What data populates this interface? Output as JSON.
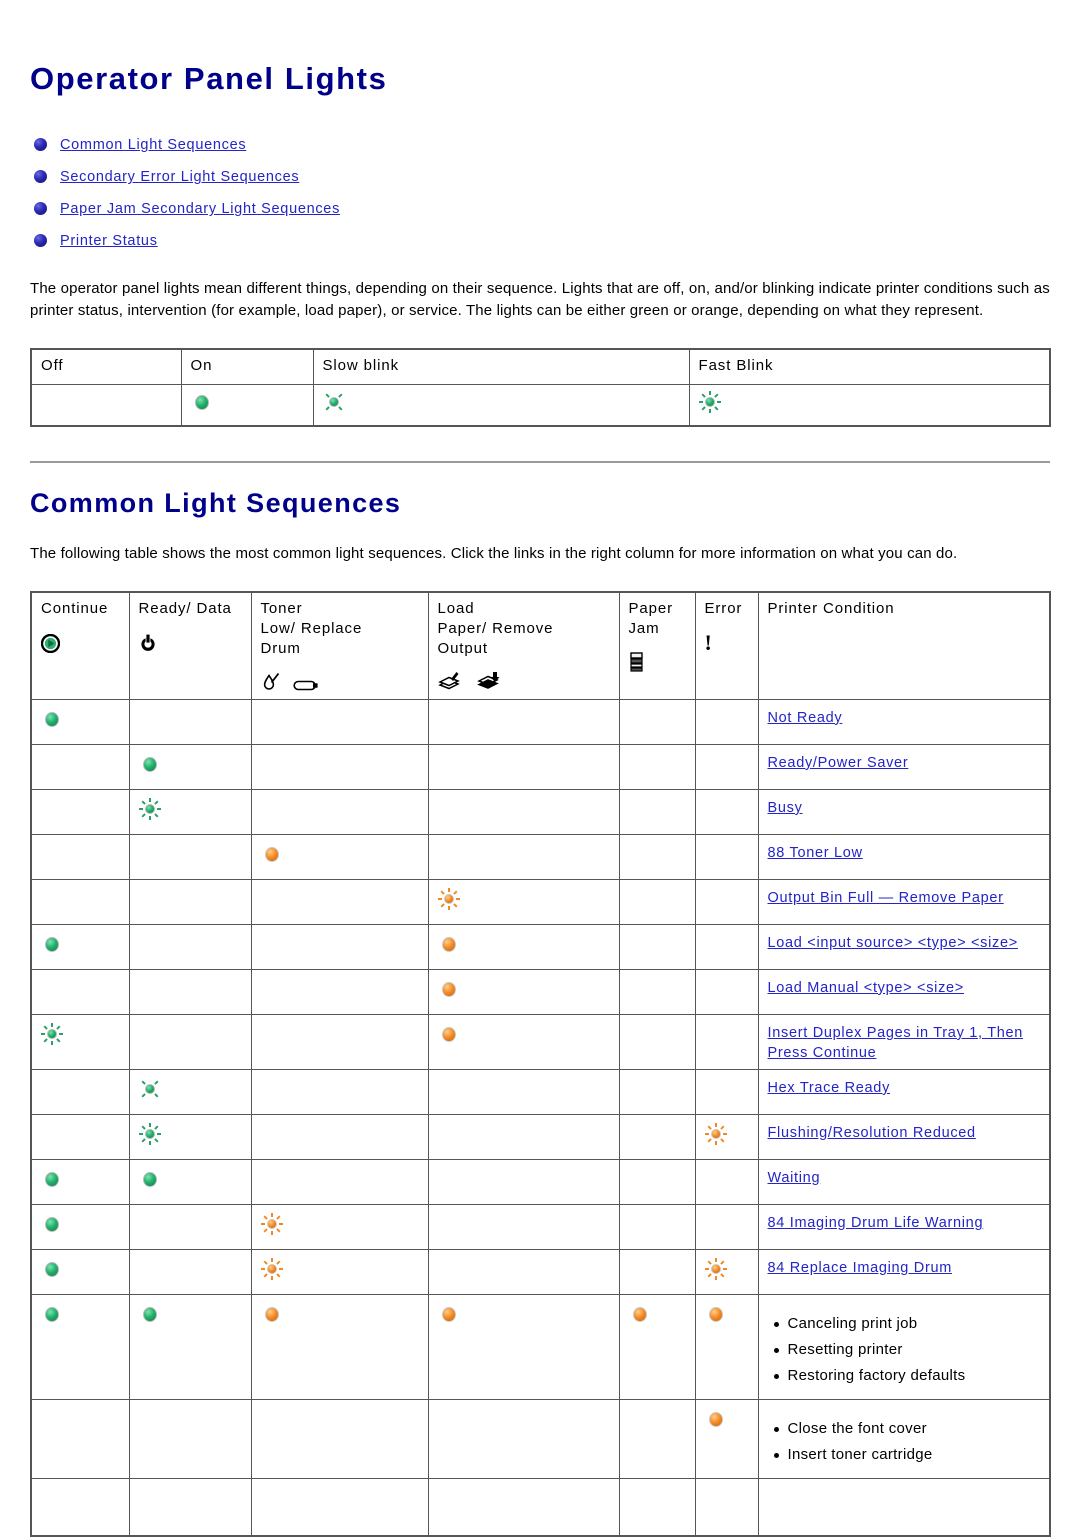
{
  "page": {
    "title": "Operator Panel Lights",
    "toc": [
      "Common Light Sequences",
      "Secondary Error Light Sequences",
      "Paper Jam Secondary Light Sequences",
      "Printer Status"
    ],
    "intro": "The operator panel lights mean different things, depending on their sequence. Lights that are off, on, and/or blinking indicate printer conditions such as printer status, intervention (for example, load paper), or service. The lights can be either green or orange, depending on what they represent.",
    "section_title": "Common Light Sequences",
    "section_intro": "The following table shows the most common light sequences. Click the links in the right column for more information on what you can do."
  },
  "colors": {
    "heading": "#00008B",
    "link": "#2424C8",
    "green_light": "#23B36D",
    "orange_light": "#F58A24",
    "table_border": "#555555"
  },
  "legend_table": {
    "headers": [
      "Off",
      "On",
      "Slow blink",
      "Fast Blink"
    ],
    "states": [
      "off",
      "on",
      "slow",
      "fast"
    ],
    "color": "green"
  },
  "main_table": {
    "headers": [
      {
        "label": "Continue",
        "icons": [
          "continue-play-icon"
        ]
      },
      {
        "label": "Ready/ Data",
        "icons": [
          "power-icon"
        ]
      },
      {
        "label": "Toner\nLow/ Replace\nDrum",
        "icons": [
          "toner-drop-slash-icon",
          "toner-cartridge-icon"
        ]
      },
      {
        "label": "Load\nPaper/ Remove\nOutput",
        "icons": [
          "load-paper-icon",
          "remove-output-icon"
        ]
      },
      {
        "label": "Paper\nJam",
        "icons": [
          "paper-jam-icon"
        ]
      },
      {
        "label": "Error",
        "icons": [
          "error-exclamation-icon"
        ]
      },
      {
        "label": "Printer Condition",
        "icons": []
      }
    ],
    "rows": [
      {
        "lights": [
          "green-on",
          "",
          "",
          "",
          "",
          ""
        ],
        "condition": "Not Ready",
        "type": "link"
      },
      {
        "lights": [
          "",
          "green-on",
          "",
          "",
          "",
          ""
        ],
        "condition": "Ready/Power Saver",
        "type": "link"
      },
      {
        "lights": [
          "",
          "green-fast",
          "",
          "",
          "",
          ""
        ],
        "condition": "Busy",
        "type": "link"
      },
      {
        "lights": [
          "",
          "",
          "orange-on",
          "",
          "",
          ""
        ],
        "condition": "88 Toner Low",
        "type": "link"
      },
      {
        "lights": [
          "",
          "",
          "",
          "orange-fast",
          "",
          ""
        ],
        "condition": "Output Bin Full — Remove Paper",
        "type": "link"
      },
      {
        "lights": [
          "green-on",
          "",
          "",
          "orange-on",
          "",
          ""
        ],
        "condition": "Load <input source> <type> <size>",
        "type": "link"
      },
      {
        "lights": [
          "",
          "",
          "",
          "orange-on",
          "",
          ""
        ],
        "condition": "Load Manual <type> <size>",
        "type": "link"
      },
      {
        "lights": [
          "green-fast",
          "",
          "",
          "orange-on",
          "",
          ""
        ],
        "condition": "Insert Duplex Pages in Tray 1, Then Press Continue",
        "type": "link"
      },
      {
        "lights": [
          "",
          "green-slow",
          "",
          "",
          "",
          ""
        ],
        "condition": "Hex Trace Ready",
        "type": "link"
      },
      {
        "lights": [
          "",
          "green-fast",
          "",
          "",
          "",
          "orange-fast"
        ],
        "condition": "Flushing/Resolution Reduced",
        "type": "link"
      },
      {
        "lights": [
          "green-on",
          "green-on",
          "",
          "",
          "",
          ""
        ],
        "condition": "Waiting",
        "type": "link"
      },
      {
        "lights": [
          "green-on",
          "",
          "orange-fast",
          "",
          "",
          ""
        ],
        "condition": "84 Imaging Drum Life Warning",
        "type": "link"
      },
      {
        "lights": [
          "green-on",
          "",
          "orange-fast",
          "",
          "",
          "orange-fast"
        ],
        "condition": "84 Replace Imaging Drum",
        "type": "link"
      },
      {
        "lights": [
          "green-on",
          "green-on",
          "orange-on",
          "orange-on",
          "orange-on",
          "orange-on"
        ],
        "type": "list",
        "items": [
          "Canceling print job",
          "Resetting printer",
          "Restoring factory defaults"
        ]
      },
      {
        "lights": [
          "",
          "",
          "",
          "",
          "",
          "orange-on"
        ],
        "type": "list",
        "items": [
          "Close the font cover",
          "Insert toner cartridge"
        ]
      }
    ]
  }
}
